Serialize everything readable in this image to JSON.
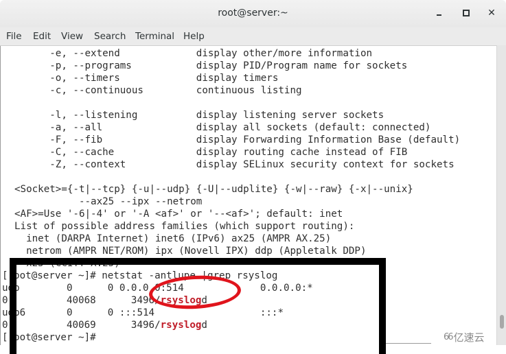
{
  "window": {
    "title": "root@server:~",
    "controls": {
      "minimize": "minimize",
      "maximize": "maximize",
      "close": "✕"
    }
  },
  "menubar": {
    "items": [
      "File",
      "Edit",
      "View",
      "Search",
      "Terminal",
      "Help"
    ]
  },
  "terminal": {
    "lines": [
      "      -e, --extend             display other/more information",
      "      -p, --programs           display PID/Program name for sockets",
      "      -o, --timers             display timers",
      "      -c, --continuous         continuous listing",
      "",
      "      -l, --listening          display listening server sockets",
      "      -a, --all                display all sockets (default: connected)",
      "      -F, --fib                display Forwarding Information Base (default)",
      "      -C, --cache              display routing cache instead of FIB",
      "      -Z, --context            display SELinux security context for sockets",
      "",
      "<Socket>={-t|--tcp} {-u|--udp} {-U|--udplite} {-w|--raw} {-x|--unix}",
      "           --ax25 --ipx --netrom",
      "<AF>=Use '-6|-4' or '-A <af>' or '--<af>'; default: inet",
      "List of possible address families (which support routing):",
      "  inet (DARPA Internet) inet6 (IPv6) ax25 (AMPR AX.25)",
      "  netrom (AMPR NET/ROM) ipx (Novell IPX) ddp (Appletalk DDP)",
      "  x25 (CCITT X.25)"
    ],
    "command_prompt": "[root@server ~]# ",
    "command": "netstat -antlupe |grep rsyslog",
    "results": [
      {
        "pre": "udp        0      0 0.0.0.0:514             0.0.0.0:*",
        "highlight": "",
        "post": ""
      },
      {
        "pre": "0          40068      3496/",
        "highlight": "rsyslog",
        "post": "d"
      },
      {
        "pre": "udp6       0      0 :::514                  :::*",
        "highlight": "",
        "post": ""
      },
      {
        "pre": "0          40069      3496/",
        "highlight": "rsyslog",
        "post": "d"
      }
    ],
    "final_prompt": "[root@server ~]#"
  },
  "annotations": {
    "highlight_color": "#e0141c",
    "box_color": "#000000"
  },
  "watermark": {
    "logo": "66",
    "text": "亿速云"
  }
}
